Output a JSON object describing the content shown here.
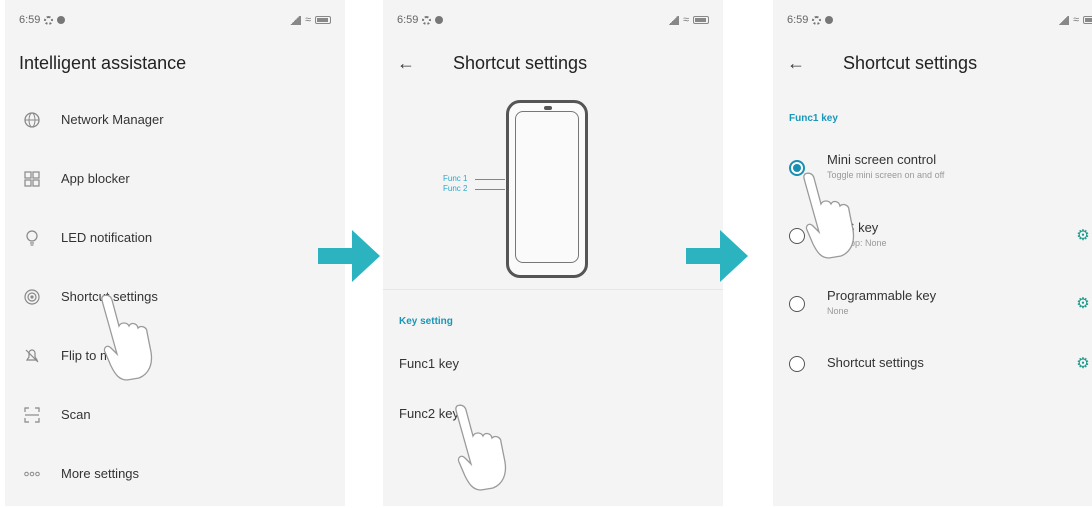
{
  "status": {
    "time": "6:59"
  },
  "panel1": {
    "title": "Intelligent assistance",
    "items": [
      {
        "label": "Network Manager",
        "icon": "globe-icon"
      },
      {
        "label": "App blocker",
        "icon": "grid-icon"
      },
      {
        "label": "LED notification",
        "icon": "bulb-icon"
      },
      {
        "label": "Shortcut settings",
        "icon": "target-icon"
      },
      {
        "label": "Flip to m",
        "icon": "bell-off-icon"
      },
      {
        "label": "Scan",
        "icon": "scan-icon"
      },
      {
        "label": "More settings",
        "icon": "more-icon"
      }
    ]
  },
  "panel2": {
    "back": "←",
    "title": "Shortcut settings",
    "func1_label": "Func 1",
    "func2_label": "Func 2",
    "section": "Key setting",
    "items": [
      {
        "label": "Func1 key"
      },
      {
        "label": "Func2 key"
      }
    ]
  },
  "panel3": {
    "back": "←",
    "title": "Shortcut settings",
    "section": "Func1 key",
    "options": [
      {
        "label": "Mini screen control",
        "sub": "Toggle mini screen on and off",
        "selected": true
      },
      {
        "label": "SOS key",
        "sub": "Call app: None",
        "selected": false
      },
      {
        "label": "Programmable key",
        "sub": "None",
        "selected": false
      },
      {
        "label": "Shortcut settings",
        "sub": "",
        "selected": false
      }
    ]
  },
  "colors": {
    "accent": "#1a96b8",
    "arrow": "#2bb3c0",
    "gear": "#1a9a8a"
  }
}
